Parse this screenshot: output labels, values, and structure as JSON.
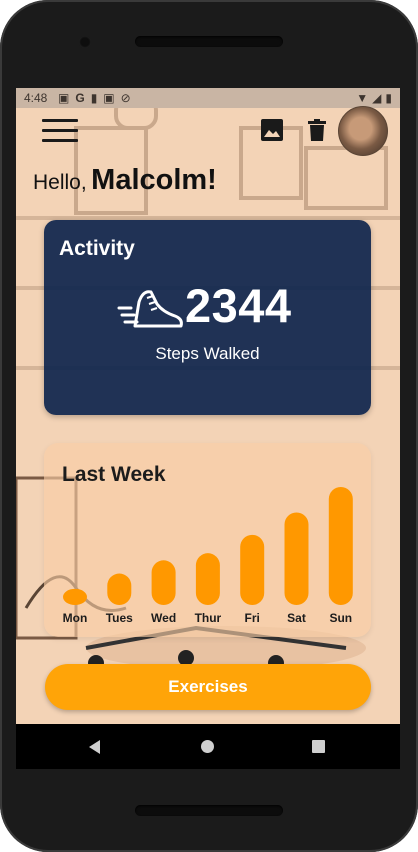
{
  "status_bar": {
    "time": "4:48",
    "left_icons": [
      "image-icon",
      "google-icon",
      "sd-card-icon",
      "gallery-icon",
      "no-sync-icon"
    ],
    "right_icons": [
      "wifi-icon",
      "signal-icon",
      "battery-icon"
    ]
  },
  "header": {
    "menu_icon": "menu-icon",
    "image_icon": "image-icon",
    "delete_icon": "trash-icon",
    "avatar": "avatar"
  },
  "greeting": {
    "hello": "Hello,",
    "name": "Malcolm!"
  },
  "activity": {
    "title": "Activity",
    "steps": "2344",
    "steps_label": "Steps Walked",
    "icon": "running-shoe-icon"
  },
  "last_week": {
    "title": "Last Week"
  },
  "chart_data": {
    "type": "bar",
    "title": "Last Week",
    "categories": [
      "Mon",
      "Tues",
      "Wed",
      "Thur",
      "Fri",
      "Sat",
      "Sun"
    ],
    "values": [
      10,
      25,
      38,
      45,
      63,
      85,
      110
    ],
    "ylim": [
      0,
      110
    ],
    "color": "#ff9800",
    "grid": false,
    "legend": "none"
  },
  "actions": {
    "exercises": "Exercises"
  },
  "colors": {
    "accent": "#ffa408",
    "card_navy": "#0f264e",
    "bar": "#ff9800"
  },
  "navigation": {
    "back": "back-icon",
    "home": "home-icon",
    "recents": "recents-icon"
  }
}
